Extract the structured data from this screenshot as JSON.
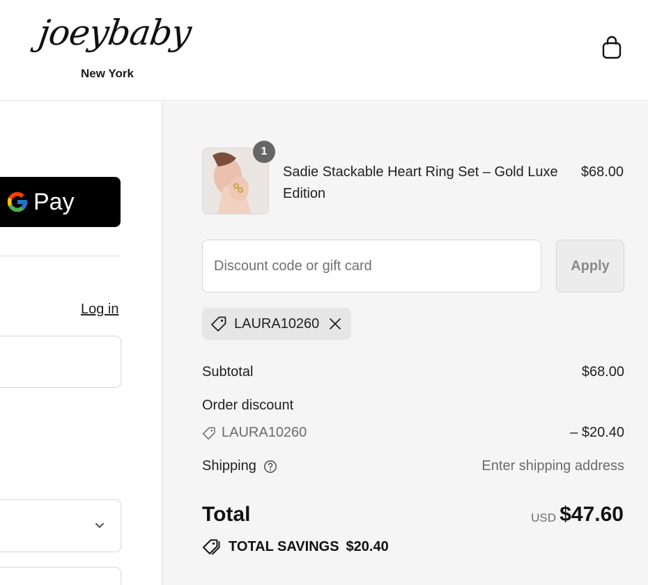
{
  "header": {
    "logo_script": "joeybaby",
    "logo_sub": "New York",
    "cart_icon": "shopping-bag-icon"
  },
  "express": {
    "gpay_label": "Pay",
    "gpay_icon": "google-g-icon"
  },
  "contact": {
    "login_label": "Log in"
  },
  "summary": {
    "product": {
      "name": "Sadie Stackable Heart Ring Set – Gold Luxe Edition",
      "price": "$68.00",
      "quantity": "1"
    },
    "discount": {
      "placeholder": "Discount code or gift card",
      "apply_label": "Apply",
      "applied_code": "LAURA10260"
    },
    "subtotal_label": "Subtotal",
    "subtotal_value": "$68.00",
    "order_discount_label": "Order discount",
    "order_discount_code": "LAURA10260",
    "order_discount_value": "– $20.40",
    "shipping_label": "Shipping",
    "shipping_value": "Enter shipping address",
    "total_label": "Total",
    "total_currency": "USD",
    "total_value": "$47.60",
    "savings_label": "TOTAL SAVINGS",
    "savings_value": "$20.40"
  },
  "colors": {
    "summary_bg": "#f5f5f5",
    "gpay_bg": "#000000",
    "badge_bg": "#666666"
  }
}
